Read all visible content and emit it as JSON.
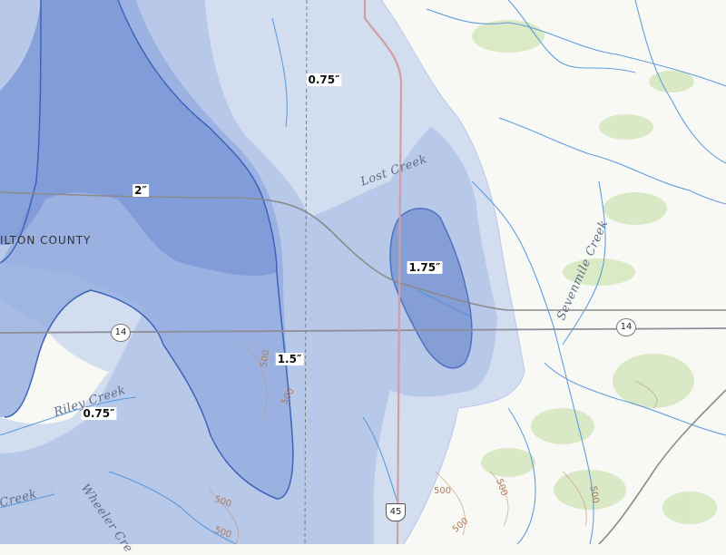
{
  "map": {
    "county_label": "ILTON COUNTY",
    "contour_labels": [
      "0.75″",
      "2″",
      "1.75″",
      "1.5″",
      "0.75″"
    ],
    "feature_labels": [
      "Lost Creek",
      "Sevenmile Creek",
      "Riley Creek",
      "Wheeler Cre",
      "Creek"
    ],
    "route_shields": [
      "14",
      "14",
      "45"
    ],
    "elevation_labels": [
      "500",
      "500",
      "500",
      "500",
      "500",
      "500",
      "500",
      "500"
    ],
    "colors": {
      "band_light": "#c9d6ee",
      "band_mid": "#9fb4e0",
      "band_dark": "#6f8fd3",
      "contour_line": "#3d63bb",
      "water": "#4a8fd8",
      "road": "#8a8a8a",
      "highway": "#c99a9a",
      "vegetation": "#cfe3b6"
    }
  }
}
